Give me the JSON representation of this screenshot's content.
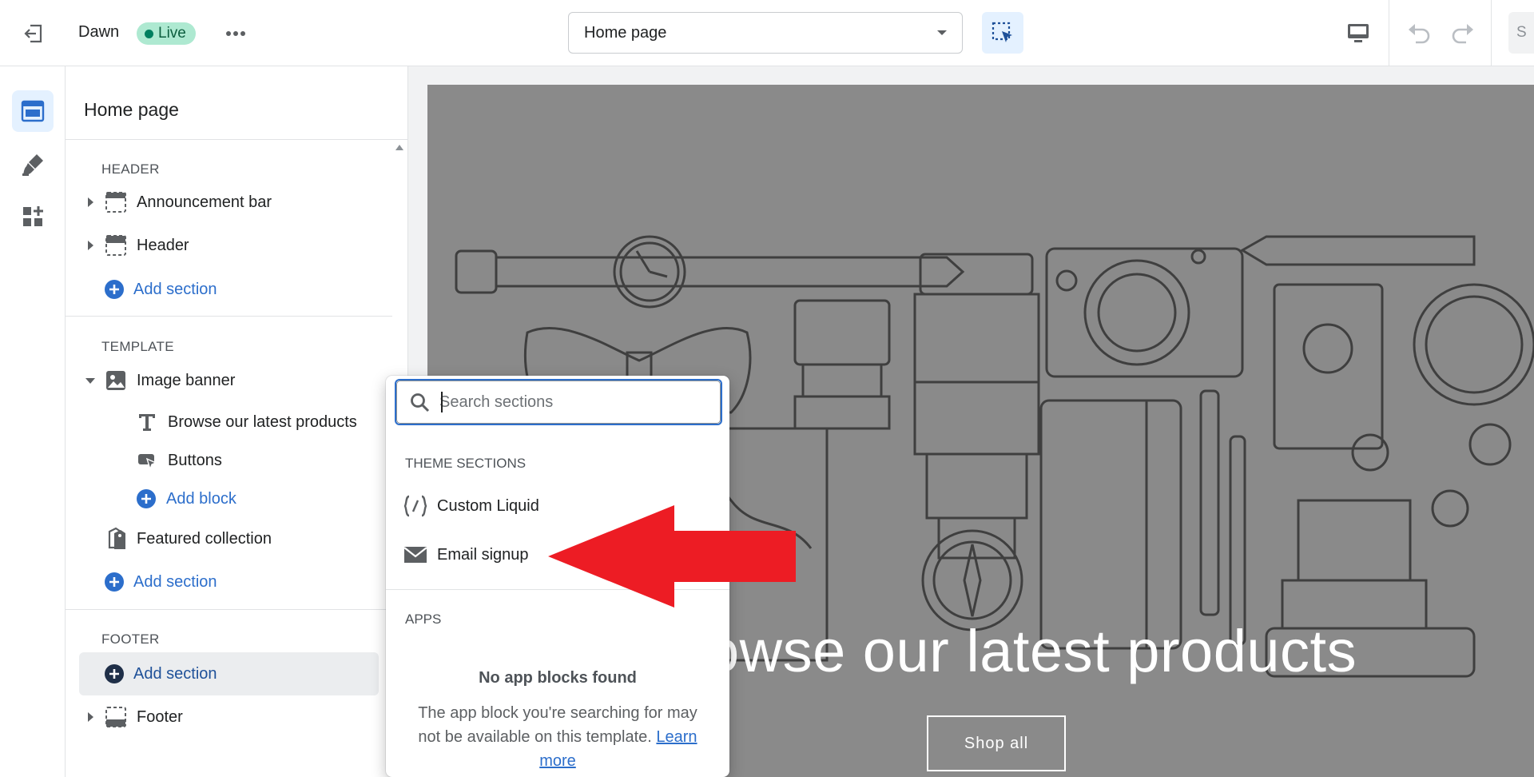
{
  "topbar": {
    "store_name": "Dawn",
    "status_badge": "Live",
    "page_selector_value": "Home page",
    "save_label": "S"
  },
  "sidebar": {
    "title": "Home page",
    "groups": [
      {
        "label": "HEADER",
        "items": [
          {
            "label": "Announcement bar"
          },
          {
            "label": "Header"
          }
        ],
        "add_label": "Add section"
      },
      {
        "label": "TEMPLATE",
        "items": [
          {
            "label": "Image banner",
            "blocks": [
              {
                "label": "Browse our latest products"
              },
              {
                "label": "Buttons"
              }
            ],
            "add_block_label": "Add block"
          },
          {
            "label": "Featured collection"
          }
        ],
        "add_label": "Add section"
      },
      {
        "label": "FOOTER",
        "add_label": "Add section",
        "items": [
          {
            "label": "Footer"
          }
        ]
      }
    ]
  },
  "popover": {
    "search_placeholder": "Search sections",
    "theme_sections_label": "THEME SECTIONS",
    "theme_sections": [
      {
        "label": "Custom Liquid",
        "icon": "liquid-code-icon"
      },
      {
        "label": "Email signup",
        "icon": "envelope-icon"
      }
    ],
    "apps_label": "APPS",
    "no_apps_title": "No app blocks found",
    "no_apps_desc": "The app block you're searching for may not be available on this template.",
    "learn_more_label": "Learn more"
  },
  "preview": {
    "hero_title": "owse our latest products",
    "hero_button": "Shop all"
  },
  "colors": {
    "accent": "#2c6ecb",
    "live_badge_bg": "#aee9d1",
    "hero_bg": "#8a8a8a",
    "annotation_arrow": "#ed1c24"
  }
}
